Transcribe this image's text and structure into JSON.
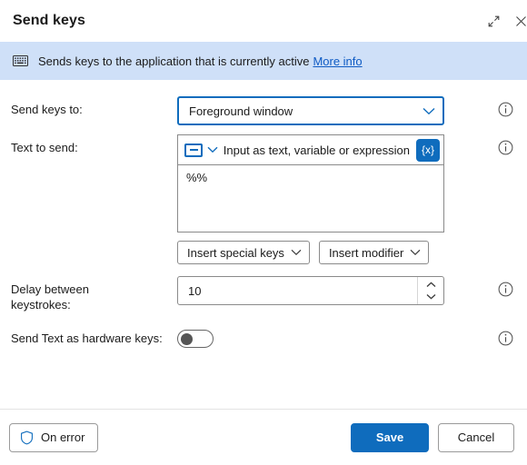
{
  "dialog": {
    "title": "Send keys",
    "expand_icon": "expand-diagonal-icon",
    "close_icon": "close-icon"
  },
  "banner": {
    "icon": "keyboard-icon",
    "text": "Sends keys to the application that is currently active",
    "link_label": "More info"
  },
  "fields": {
    "send_keys_to": {
      "label": "Send keys to:",
      "value": "Foreground window",
      "chevron_icon": "chevron-down-icon",
      "info_icon": "info-icon"
    },
    "text_to_send": {
      "label": "Text to send:",
      "mode_icon": "text-input-mode-icon",
      "mode_chevron_icon": "chevron-down-icon",
      "hint": "Input as text, variable or expression",
      "variable_button_label": "{x}",
      "value": "%%",
      "insert_special_keys_label": "Insert special keys",
      "insert_modifier_label": "Insert modifier",
      "info_icon": "info-icon"
    },
    "delay": {
      "label": "Delay between\nkeystrokes:",
      "label_line1": "Delay between",
      "label_line2": "keystrokes:",
      "value": "10",
      "increment_icon": "chevron-up-icon",
      "decrement_icon": "chevron-down-icon",
      "info_icon": "info-icon"
    },
    "hardware_keys": {
      "label": "Send Text as hardware keys:",
      "state": "off",
      "info_icon": "info-icon"
    }
  },
  "footer": {
    "on_error_label": "On error",
    "on_error_icon": "shield-icon",
    "save_label": "Save",
    "cancel_label": "Cancel"
  },
  "colors": {
    "accent": "#0f6cbd",
    "banner_background": "#cfe0f8",
    "link": "#0f5bc4",
    "border": "#8a8a8a"
  }
}
